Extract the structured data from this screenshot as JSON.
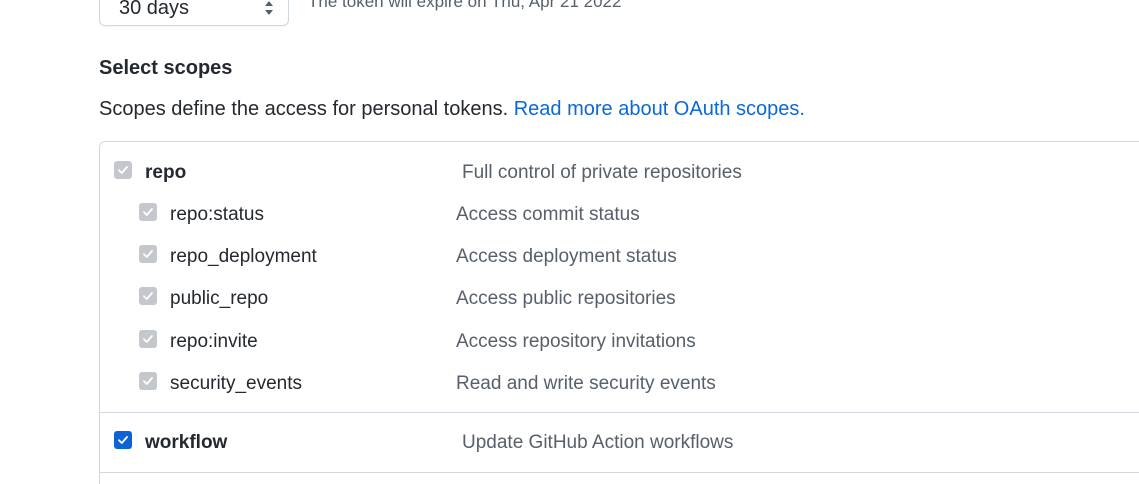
{
  "expiration": {
    "selected": "30 days",
    "note": "The token will expire on Thu, Apr 21 2022"
  },
  "scopes_section": {
    "title": "Select scopes",
    "description": "Scopes define the access for personal tokens.",
    "link_label": "Read more about OAuth scopes."
  },
  "scopes": {
    "repo": {
      "name": "repo",
      "description": "Full control of private repositories",
      "checked": true,
      "disabled": true,
      "children": [
        {
          "name": "repo:status",
          "description": "Access commit status"
        },
        {
          "name": "repo_deployment",
          "description": "Access deployment status"
        },
        {
          "name": "public_repo",
          "description": "Access public repositories"
        },
        {
          "name": "repo:invite",
          "description": "Access repository invitations"
        },
        {
          "name": "security_events",
          "description": "Read and write security events"
        }
      ]
    },
    "workflow": {
      "name": "workflow",
      "description": "Update GitHub Action workflows",
      "checked": true,
      "disabled": false
    }
  },
  "colors": {
    "link": "#0969da",
    "checkbox_checked": "#0b63d6",
    "checkbox_disabled": "#c4c8cc",
    "border": "#d0d7de"
  }
}
